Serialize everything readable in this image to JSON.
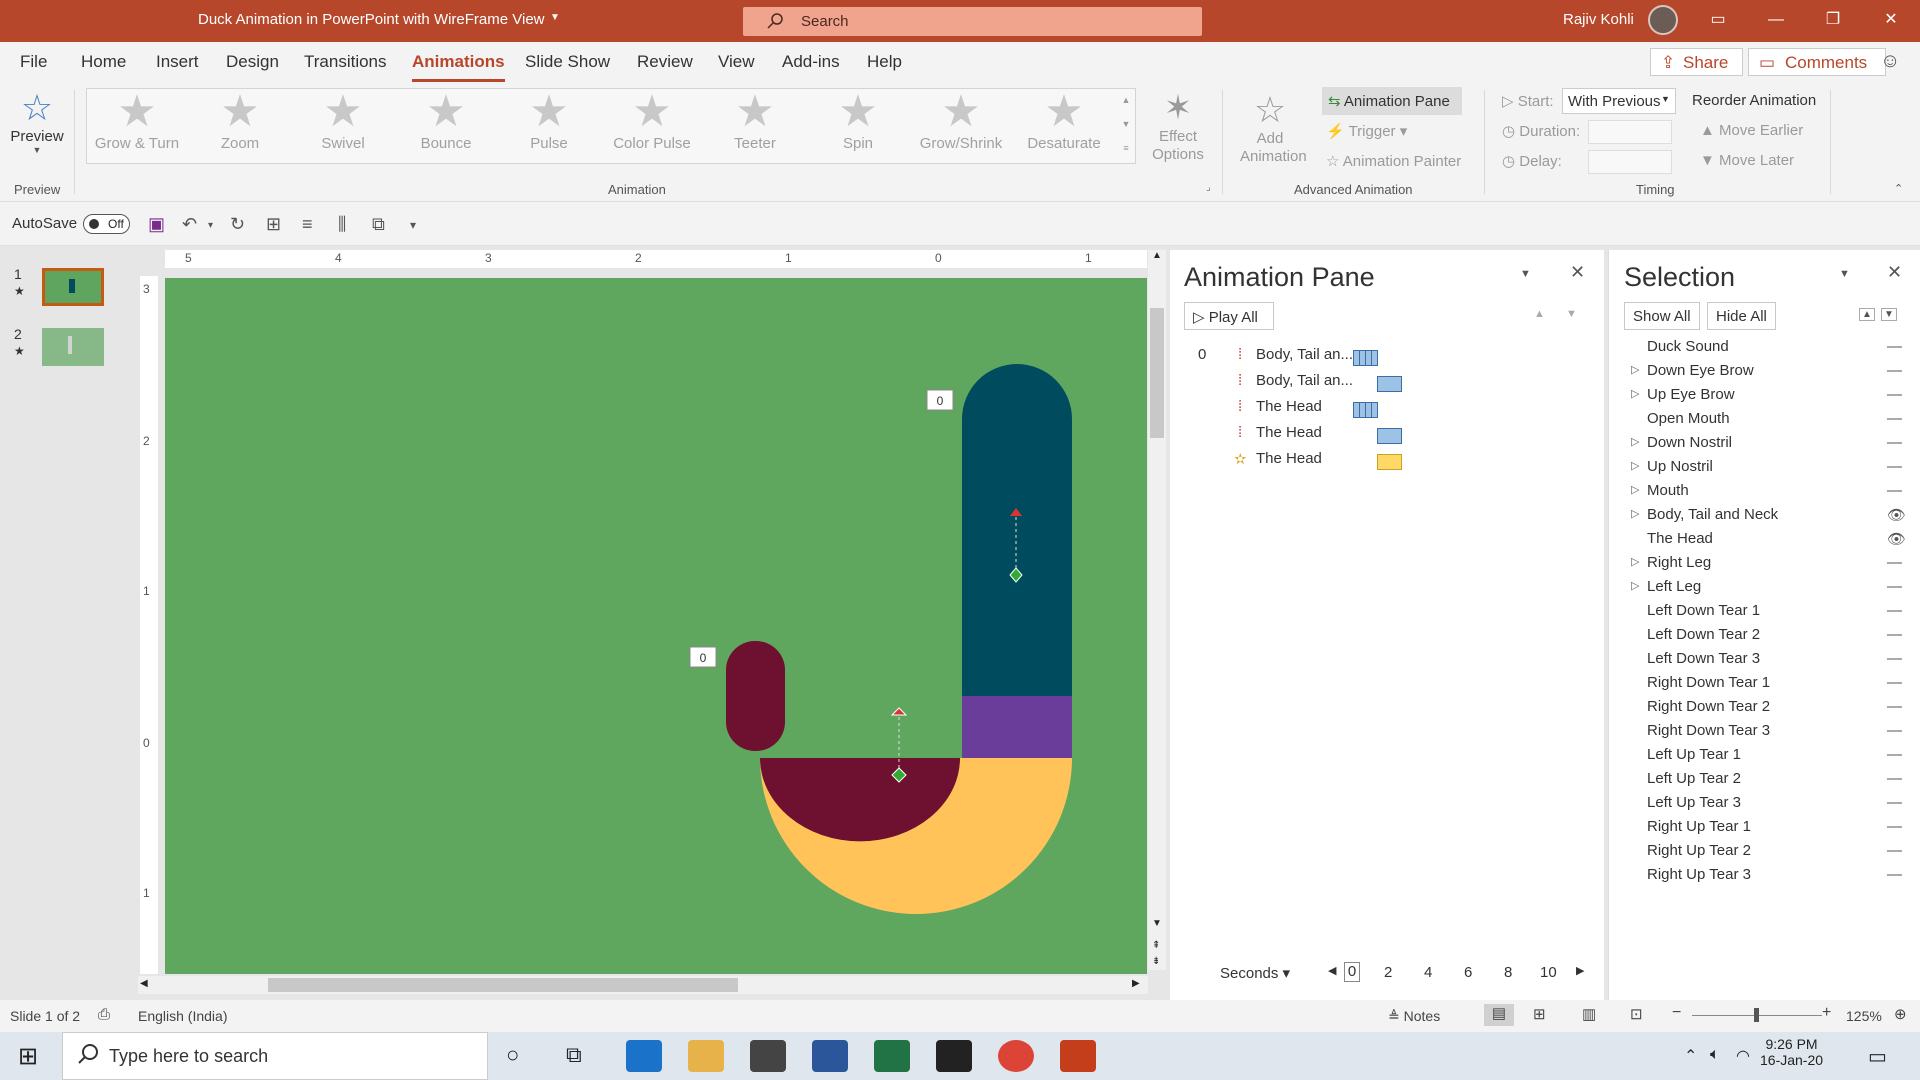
{
  "window": {
    "title": "Duck Animation in PowerPoint with WireFrame View",
    "search_placeholder": "Search",
    "user": "Rajiv Kohli"
  },
  "menu": {
    "items": [
      "File",
      "Home",
      "Insert",
      "Design",
      "Transitions",
      "Animations",
      "Slide Show",
      "Review",
      "View",
      "Add-ins",
      "Help"
    ],
    "active": "Animations",
    "share": "Share",
    "comments": "Comments"
  },
  "ribbon": {
    "preview": "Preview",
    "preview_group": "Preview",
    "effects": [
      "Grow & Turn",
      "Zoom",
      "Swivel",
      "Bounce",
      "Pulse",
      "Color Pulse",
      "Teeter",
      "Spin",
      "Grow/Shrink",
      "Desaturate"
    ],
    "effect_options": "Effect Options",
    "animation_group": "Animation",
    "add_animation": "Add Animation",
    "animation_pane": "Animation Pane",
    "trigger": "Trigger",
    "animation_painter": "Animation Painter",
    "advanced_group": "Advanced Animation",
    "start_label": "Start:",
    "start_value": "With Previous",
    "duration_label": "Duration:",
    "delay_label": "Delay:",
    "reorder": "Reorder Animation",
    "move_earlier": "Move Earlier",
    "move_later": "Move Later",
    "timing_group": "Timing"
  },
  "qat": {
    "autosave": "AutoSave",
    "toggle": "Off"
  },
  "slides": [
    {
      "num": "1",
      "selected": true
    },
    {
      "num": "2",
      "selected": false
    }
  ],
  "ruler_h": [
    "5",
    "4",
    "3",
    "2",
    "1",
    "0",
    "1"
  ],
  "ruler_v": [
    "3",
    "2",
    "1",
    "0",
    "1"
  ],
  "slide_tags": [
    "0",
    "0"
  ],
  "colors": {
    "slide_bg": "#5fa65f",
    "head": "#004b5e",
    "neck_band": "#6a3d9a",
    "body": "#ffc35a",
    "wing": "#6e1030",
    "accent": "#b7472a"
  },
  "animation_pane": {
    "title": "Animation Pane",
    "play_all": "Play All",
    "rows": [
      {
        "num": "0",
        "label": "Body, Tail an...",
        "bar": "motion"
      },
      {
        "num": "",
        "label": "Body, Tail an...",
        "bar": "blue"
      },
      {
        "num": "",
        "label": "The Head",
        "bar": "motion"
      },
      {
        "num": "",
        "label": "The Head",
        "bar": "blue"
      },
      {
        "num": "",
        "label": "The Head",
        "bar": "yellow"
      }
    ],
    "seconds": "Seconds",
    "ticks": [
      "0",
      "2",
      "4",
      "6",
      "8",
      "10"
    ]
  },
  "selection_pane": {
    "title": "Selection",
    "show_all": "Show All",
    "hide_all": "Hide All",
    "items": [
      {
        "label": "Duck Sound",
        "expand": false,
        "visible": false
      },
      {
        "label": "Down Eye Brow",
        "expand": true,
        "visible": false
      },
      {
        "label": "Up Eye Brow",
        "expand": true,
        "visible": false
      },
      {
        "label": "Open Mouth",
        "expand": false,
        "visible": false
      },
      {
        "label": "Down Nostril",
        "expand": true,
        "visible": false
      },
      {
        "label": "Up Nostril",
        "expand": true,
        "visible": false
      },
      {
        "label": "Mouth",
        "expand": true,
        "visible": false
      },
      {
        "label": "Body, Tail and Neck",
        "expand": true,
        "visible": true
      },
      {
        "label": "The Head",
        "expand": false,
        "visible": true
      },
      {
        "label": "Right Leg",
        "expand": true,
        "visible": false
      },
      {
        "label": "Left Leg",
        "expand": true,
        "visible": false
      },
      {
        "label": "Left Down Tear 1",
        "expand": false,
        "visible": false
      },
      {
        "label": "Left Down Tear 2",
        "expand": false,
        "visible": false
      },
      {
        "label": "Left Down Tear 3",
        "expand": false,
        "visible": false
      },
      {
        "label": "Right Down Tear 1",
        "expand": false,
        "visible": false
      },
      {
        "label": "Right Down Tear 2",
        "expand": false,
        "visible": false
      },
      {
        "label": "Right Down Tear 3",
        "expand": false,
        "visible": false
      },
      {
        "label": "Left Up Tear 1",
        "expand": false,
        "visible": false
      },
      {
        "label": "Left Up Tear 2",
        "expand": false,
        "visible": false
      },
      {
        "label": "Left Up Tear 3",
        "expand": false,
        "visible": false
      },
      {
        "label": "Right Up Tear 1",
        "expand": false,
        "visible": false
      },
      {
        "label": "Right Up Tear 2",
        "expand": false,
        "visible": false
      },
      {
        "label": "Right Up Tear 3",
        "expand": false,
        "visible": false
      }
    ]
  },
  "status": {
    "slide": "Slide 1 of 2",
    "language": "English (India)",
    "notes": "Notes",
    "zoom": "125%"
  },
  "taskbar": {
    "search": "Type here to search",
    "time": "9:26 PM",
    "date": "16-Jan-20"
  }
}
